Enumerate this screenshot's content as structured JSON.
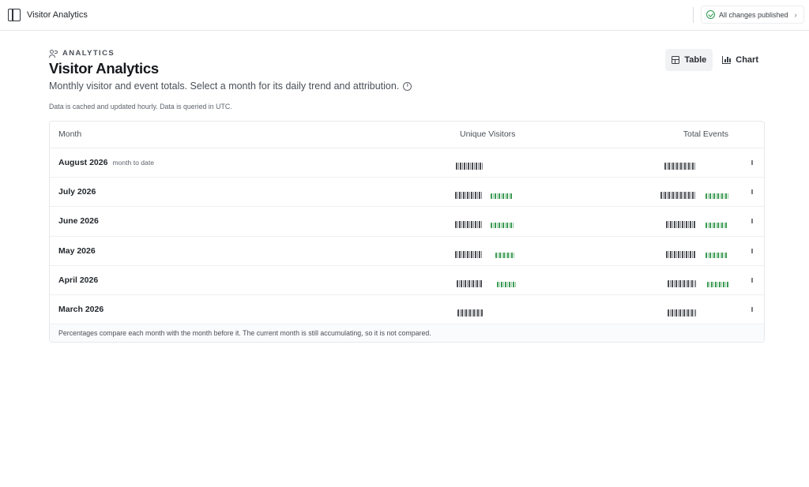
{
  "topbar": {
    "title": "Visitor Analytics",
    "publish_status": "All changes published"
  },
  "header": {
    "eyebrow": "ANALYTICS",
    "title": "Visitor Analytics",
    "subtitle": "Monthly visitor and event totals. Select a month for its daily trend and attribution.",
    "cache_note": "Data is cached and updated hourly. Data is queried in UTC."
  },
  "view_toggle": {
    "table_label": "Table",
    "chart_label": "Chart",
    "active": "Table"
  },
  "table": {
    "columns": [
      "Month",
      "Unique Visitors",
      "Total Events"
    ],
    "rows": [
      {
        "month": "August 2026",
        "badge": "month to date"
      },
      {
        "month": "July 2026",
        "badge": ""
      },
      {
        "month": "June 2026",
        "badge": ""
      },
      {
        "month": "May 2026",
        "badge": ""
      },
      {
        "month": "April 2026",
        "badge": ""
      },
      {
        "month": "March 2026",
        "badge": ""
      }
    ],
    "footnote": "Percentages compare each month with the month before it. The current month is still accumulating, so it is not compared."
  },
  "colors": {
    "positive_delta": "#3a9a52",
    "success": "#2e9c52"
  },
  "icons": [
    "sidebar-toggle-icon",
    "check-circle-icon",
    "chevron-right-icon",
    "users-icon",
    "info-icon",
    "table-icon",
    "bar-chart-icon"
  ]
}
